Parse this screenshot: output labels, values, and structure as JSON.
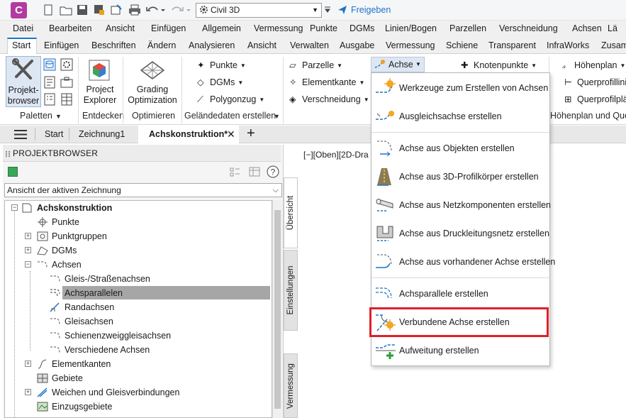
{
  "quick_access": {
    "app_icon_letter": "C",
    "workspace": "Civil 3D",
    "share_label": "Freigeben"
  },
  "menu_bar": [
    "Datei",
    "Bearbeiten",
    "Ansicht",
    "Einfügen",
    "Allgemein",
    "Vermessung",
    "Punkte",
    "DGMs",
    "Linien/Bogen",
    "Parzellen",
    "Verschneidung",
    "Achsen",
    "Lä"
  ],
  "ribbon_tabs": [
    "Start",
    "Einfügen",
    "Beschriften",
    "Ändern",
    "Analysieren",
    "Ansicht",
    "Verwalten",
    "Ausgabe",
    "Vermessung",
    "Schiene",
    "Transparent",
    "InfraWorks",
    "Zusam"
  ],
  "ribbon": {
    "palettes": {
      "button": "Projekt-\nbrowser",
      "panel": "Paletten"
    },
    "explore": {
      "button": "Project\nExplorer",
      "panel": "Entdecken"
    },
    "optimize": {
      "button": "Grading\nOptimization",
      "panel": "Optimieren"
    },
    "terrain": {
      "panel": "Geländedaten erstellen",
      "buttons": [
        "Punkte",
        "DGMs",
        "Polygonzug"
      ]
    },
    "create": {
      "buttons": [
        "Parzelle",
        "Elementkante",
        "Verschneidung"
      ]
    },
    "achse": "Achse",
    "knoten": "Knotenpunkte",
    "profile": {
      "buttons": [
        "Höhenplan",
        "Querprofillini",
        "Querprofilplä"
      ],
      "panel": "Höhenplan und Quer"
    }
  },
  "doc_tabs": {
    "start": "Start",
    "tab1": "Zeichnung1",
    "tab2": "Achskonstruktion*"
  },
  "project_browser": {
    "title": "PROJEKTBROWSER",
    "view_select": "Ansicht der aktiven Zeichnung",
    "tree": [
      {
        "label": "Achskonstruktion",
        "bold": true
      },
      {
        "label": "Punkte"
      },
      {
        "label": "Punktgruppen"
      },
      {
        "label": "DGMs"
      },
      {
        "label": "Achsen"
      },
      {
        "label": "Gleis-/Straßenachsen"
      },
      {
        "label": "Achsparallelen",
        "selected": true
      },
      {
        "label": "Randachsen"
      },
      {
        "label": "Gleisachsen"
      },
      {
        "label": "Schienenzweiggleisachsen"
      },
      {
        "label": "Verschiedene Achsen"
      },
      {
        "label": "Elementkanten"
      },
      {
        "label": "Gebiete"
      },
      {
        "label": "Weichen und Gleisverbindungen"
      },
      {
        "label": "Einzugsgebiete"
      }
    ],
    "side_tabs": [
      "Übersicht",
      "Einstellungen",
      "Vermessung"
    ]
  },
  "viewport_label": "[−][Oben][2D-Dra",
  "achse_menu": [
    "Werkzeuge zum Erstellen von Achsen",
    "Ausgleichsachse erstellen",
    "Achse aus Objekten erstellen",
    "Achse aus 3D-Profilkörper erstellen",
    "Achse aus Netzkomponenten erstellen",
    "Achse aus Druckleitungsnetz erstellen",
    "Achse aus vorhandener Achse erstellen",
    "Achsparallele erstellen",
    "Verbundene Achse erstellen",
    "Aufweitung erstellen"
  ],
  "colors": {
    "accent": "#1e73c8",
    "highlight": "#e0202a",
    "selection": "#a6a6a6",
    "app_icon": "#b23aa0"
  }
}
